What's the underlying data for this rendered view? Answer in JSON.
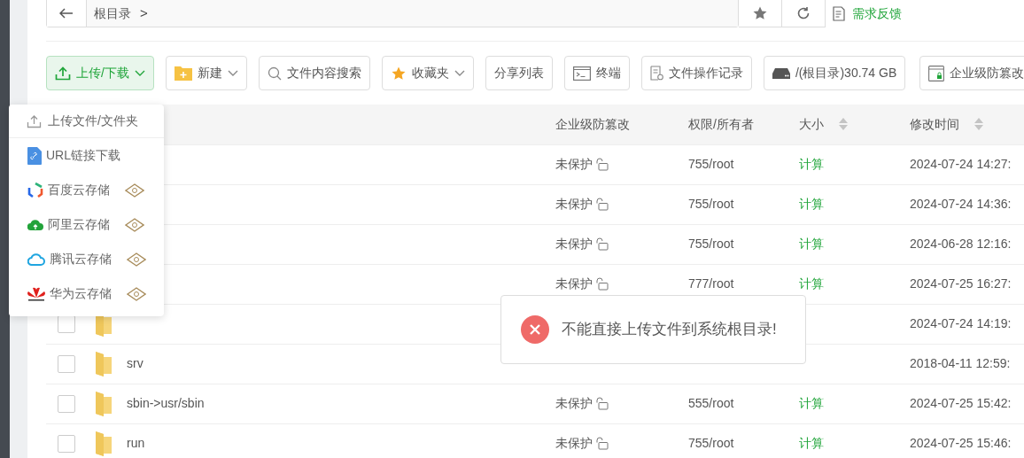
{
  "breadcrumb": {
    "segments": [
      "根目录"
    ],
    "separator": ">"
  },
  "feedback": {
    "label": "需求反馈"
  },
  "toolbar": [
    {
      "label": "上传/下载",
      "active": true,
      "dropdown": true
    },
    {
      "label": "新建",
      "active": false,
      "dropdown": true
    },
    {
      "label": "文件内容搜索",
      "active": false,
      "dropdown": false
    },
    {
      "label": "收藏夹",
      "active": false,
      "dropdown": true
    },
    {
      "label": "分享列表",
      "active": false,
      "dropdown": false
    },
    {
      "label": "终端",
      "active": false,
      "dropdown": false
    },
    {
      "label": "文件操作记录",
      "active": false,
      "dropdown": false
    },
    {
      "label": "/(根目录)30.74 GB",
      "active": false,
      "dropdown": false
    },
    {
      "label": "企业级防篡改",
      "active": false,
      "dropdown": false
    }
  ],
  "table": {
    "columns": [
      {
        "label": "企业级防篡改",
        "sortable": false
      },
      {
        "label": "权限/所有者",
        "sortable": false
      },
      {
        "label": "大小",
        "sortable": true
      },
      {
        "label": "修改时间",
        "sortable": true
      }
    ],
    "rows": [
      {
        "protection": "未保护",
        "permissions": "755/root",
        "size": "计算",
        "modified": "2024-07-24 14:27:"
      },
      {
        "protection": "未保护",
        "permissions": "755/root",
        "size": "计算",
        "modified": "2024-07-24 14:36:"
      },
      {
        "protection": "未保护",
        "permissions": "755/root",
        "size": "计算",
        "modified": "2024-06-28 12:16:"
      },
      {
        "protection": "未保护",
        "permissions": "777/root",
        "size": "计算",
        "modified": "2024-07-25 16:27:"
      },
      {
        "checked": false,
        "modified": "2024-07-24 14:19:"
      },
      {
        "checked": false,
        "name": "srv",
        "modified": "2018-04-11 12:59:"
      },
      {
        "checked": false,
        "name": "sbin->usr/sbin",
        "protection": "未保护",
        "permissions": "555/root",
        "size": "计算",
        "modified": "2024-07-25 15:42:"
      },
      {
        "checked": false,
        "name": "run",
        "protection": "未保护",
        "permissions": "755/root",
        "size": "计算",
        "modified": "2024-07-25 15:46:"
      }
    ]
  },
  "dropdown": {
    "top_item": {
      "label": "上传文件/文件夹"
    },
    "items": [
      {
        "label": "URL链接下载",
        "pro": false
      },
      {
        "label": "百度云存储",
        "pro": true
      },
      {
        "label": "阿里云存储",
        "pro": true
      },
      {
        "label": "腾讯云存储",
        "pro": true
      },
      {
        "label": "华为云存储",
        "pro": true
      }
    ]
  },
  "toast": {
    "kind": "error",
    "message": "不能直接上传文件到系统根目录!"
  }
}
